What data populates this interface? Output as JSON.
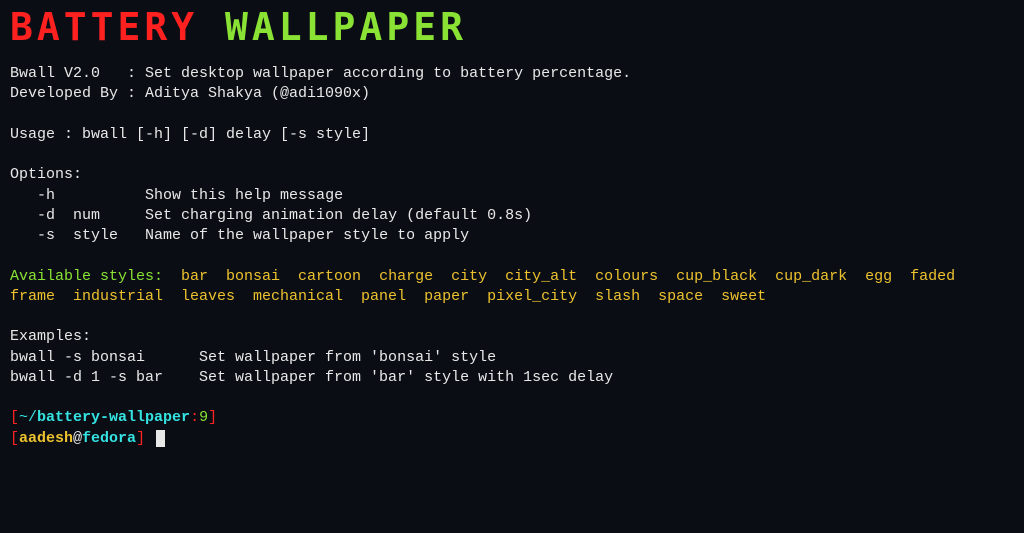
{
  "banner": {
    "word1": "BATTERY",
    "word2": "WALLPAPER"
  },
  "info_line1": "Bwall V2.0   : Set desktop wallpaper according to battery percentage.",
  "info_line2": "Developed By : Aditya Shakya (@adi1090x)",
  "usage_line": "Usage : bwall [-h] [-d] delay [-s style]",
  "options_header": "Options:",
  "option_h": "   -h          Show this help message",
  "option_d": "   -d  num     Set charging animation delay (default 0.8s)",
  "option_s": "   -s  style   Name of the wallpaper style to apply",
  "styles_label": "Available styles:",
  "styles_list": "  bar  bonsai  cartoon  charge  city  city_alt  colours  cup_black  cup_dark  egg  faded  frame  industrial  leaves  mechanical  panel  paper  pixel_city  slash  space  sweet",
  "examples_header": "Examples:",
  "example1": "bwall -s bonsai      Set wallpaper from 'bonsai' style",
  "example2": "bwall -d 1 -s bar    Set wallpaper from 'bar' style with 1sec delay",
  "prompt1": {
    "open": "[",
    "path_tilde": "~/",
    "path": "battery-wallpaper",
    "colon": ":",
    "num": "9",
    "close": "]"
  },
  "prompt2": {
    "open": "[",
    "user": "aadesh",
    "at": "@",
    "host": "fedora",
    "close": "]"
  }
}
